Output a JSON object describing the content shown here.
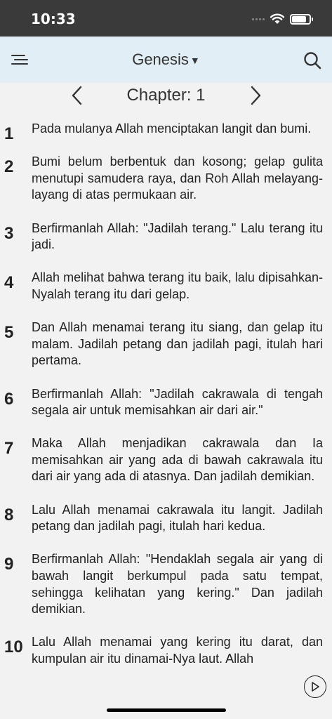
{
  "status_bar": {
    "time": "10:33",
    "battery_level": 0.85
  },
  "nav": {
    "book": "Genesis",
    "icons": [
      "menu-icon",
      "search-icon",
      "caret-down-icon"
    ]
  },
  "chapter": {
    "label": "Chapter: 1",
    "icons": [
      "chevron-left-icon",
      "chevron-right-icon"
    ]
  },
  "verses": [
    {
      "num": "1",
      "text": "Pada mulanya Allah menciptakan langit dan bumi."
    },
    {
      "num": "2",
      "text": "Bumi belum berbentuk dan kosong; gelap gulita menutupi samudera raya, dan Roh Allah melayang-layang di atas permukaan air."
    },
    {
      "num": "3",
      "text": "Berfirmanlah Allah: \"Jadilah terang.\" Lalu terang itu jadi."
    },
    {
      "num": "4",
      "text": "Allah melihat bahwa terang itu baik, lalu dipisahkan-Nyalah terang itu dari gelap."
    },
    {
      "num": "5",
      "text": "Dan Allah menamai terang itu siang, dan gelap itu malam. Jadilah petang dan jadilah pagi, itulah hari pertama."
    },
    {
      "num": "6",
      "text": "Berfirmanlah Allah: \"Jadilah cakrawala di tengah segala air untuk memisahkan air dari air.\""
    },
    {
      "num": "7",
      "text": "Maka Allah menjadikan cakrawala dan Ia memisahkan air yang ada di bawah cakrawala itu dari air yang ada di atasnya. Dan jadilah demikian."
    },
    {
      "num": "8",
      "text": "Lalu Allah menamai cakrawala itu langit. Jadilah petang dan jadilah pagi, itulah hari kedua."
    },
    {
      "num": "9",
      "text": "Berfirmanlah Allah: \"Hendaklah segala air yang di bawah langit berkumpul pada satu tempat, sehingga kelihatan yang kering.\" Dan jadilah demikian."
    },
    {
      "num": "10",
      "text": "Lalu Allah menamai yang kering itu darat, dan kumpulan air itu dinamai-Nya laut. Allah"
    }
  ],
  "controls": {
    "play_icon": "play-circle-icon"
  }
}
